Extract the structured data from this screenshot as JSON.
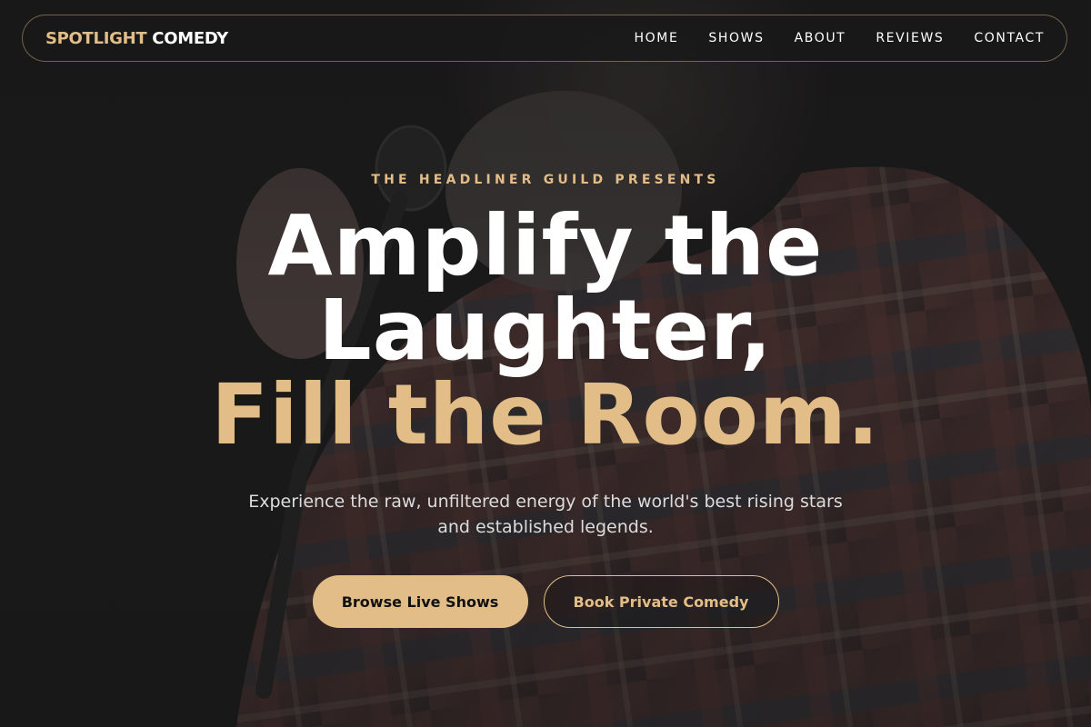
{
  "brand": {
    "accent": "SPOTLIGHT",
    "name": "COMEDY"
  },
  "nav": {
    "items": [
      {
        "label": "HOME"
      },
      {
        "label": "SHOWS"
      },
      {
        "label": "ABOUT"
      },
      {
        "label": "REVIEWS"
      },
      {
        "label": "CONTACT"
      }
    ]
  },
  "hero": {
    "eyebrow": "THE HEADLINER GUILD PRESENTS",
    "headline_line1": "Amplify the",
    "headline_line2": "Laughter,",
    "headline_line3": "Fill the Room.",
    "subtext": "Experience the raw, unfiltered energy of the world's best rising stars and established legends.",
    "primary_cta": "Browse Live Shows",
    "secondary_cta": "Book Private Comedy"
  },
  "colors": {
    "accent": "#e3bd87",
    "background": "#1a1919",
    "text": "#ffffff"
  },
  "icons": {
    "background_image": "comedian-with-microphone-photo"
  }
}
